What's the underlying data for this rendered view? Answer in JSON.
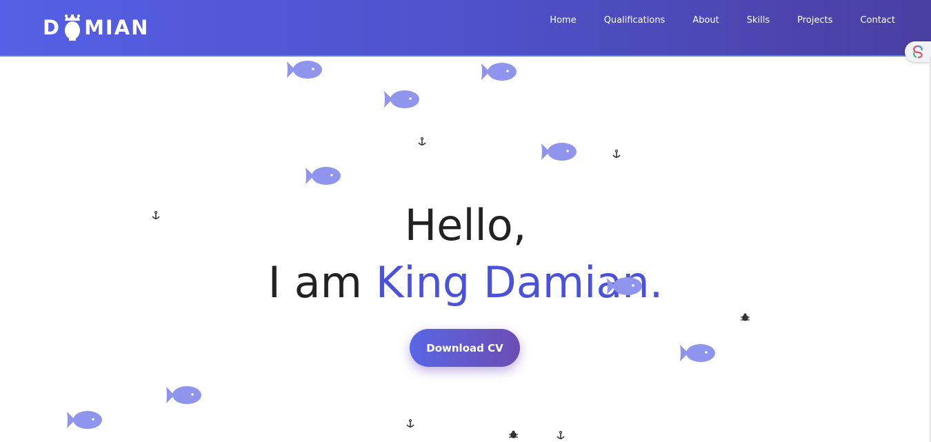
{
  "header": {
    "logo": {
      "first_letter": "D",
      "rest": "MIAN",
      "icon": "crowned-head-icon"
    },
    "nav": [
      {
        "label": "Home"
      },
      {
        "label": "Qualifications"
      },
      {
        "label": "About"
      },
      {
        "label": "Skills"
      },
      {
        "label": "Projects"
      },
      {
        "label": "Contact"
      }
    ]
  },
  "side_badge": {
    "icon": "extension-swirl-icon"
  },
  "hero": {
    "greeting": "Hello,",
    "intro_prefix": "I am",
    "name": "King Damian."
  },
  "cta": {
    "label": "Download CV"
  },
  "decor": {
    "fish_icon": "fish-icon",
    "anchor_icon": "anchor-icon",
    "bug_icon": "bug-icon"
  },
  "colors": {
    "header_gradient_start": "#5560e6",
    "header_gradient_end": "#4a3fa2",
    "accent": "#4a52dc",
    "fish": "#8f95ec",
    "text": "#222222"
  }
}
